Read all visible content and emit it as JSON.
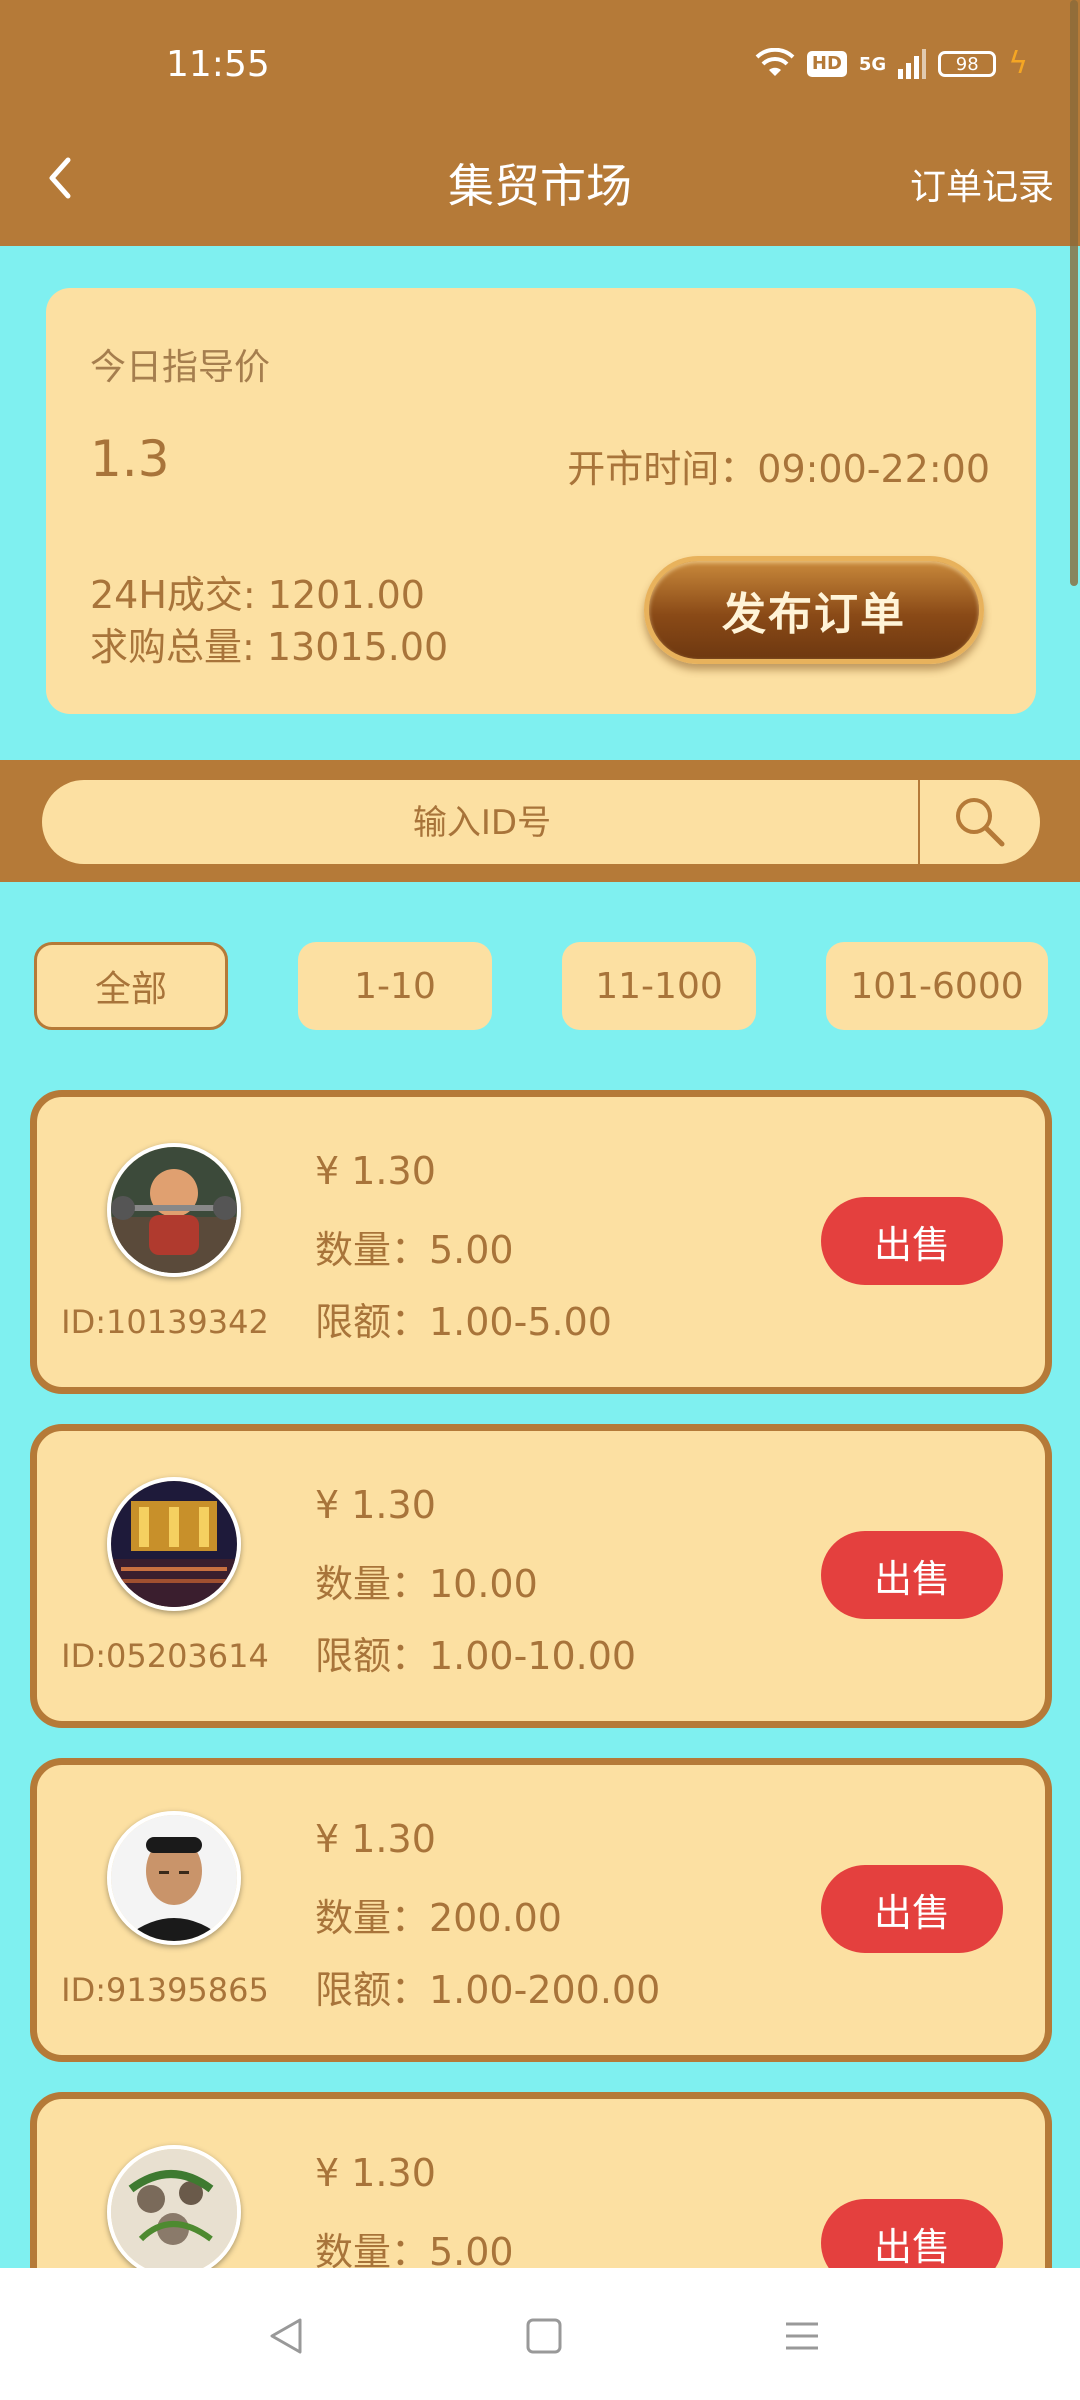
{
  "status": {
    "time": "11:55",
    "network": "5G",
    "hd": "HD",
    "battery": "98"
  },
  "header": {
    "title": "集贸市场",
    "right_link": "订单记录"
  },
  "summary": {
    "label": "今日指导价",
    "price": "1.3",
    "hours": "开市时间：09:00-22:00",
    "volume": "24H成交: 1201.00",
    "total": "求购总量: 13015.00",
    "publish_label": "发布订单"
  },
  "search": {
    "placeholder": "输入ID号"
  },
  "filters": [
    {
      "label": "全部",
      "active": true
    },
    {
      "label": "1-10"
    },
    {
      "label": "11-100"
    },
    {
      "label": "101-6000"
    }
  ],
  "orders": [
    {
      "id": "ID:10139342",
      "price": "¥ 1.30",
      "qty": "数量：5.00",
      "limit": "限额：1.00-5.00",
      "action": "出售"
    },
    {
      "id": "ID:05203614",
      "price": "¥ 1.30",
      "qty": "数量：10.00",
      "limit": "限额：1.00-10.00",
      "action": "出售"
    },
    {
      "id": "ID:91395865",
      "price": "¥ 1.30",
      "qty": "数量：200.00",
      "limit": "限额：1.00-200.00",
      "action": "出售"
    },
    {
      "id": "",
      "price": "¥ 1.30",
      "qty": "数量：5.00",
      "limit": "",
      "action": "出售"
    }
  ],
  "colors": {
    "header": "#B57A38",
    "background": "#7FF0F0",
    "card": "#FCE0A2",
    "sell": "#E4403E"
  }
}
